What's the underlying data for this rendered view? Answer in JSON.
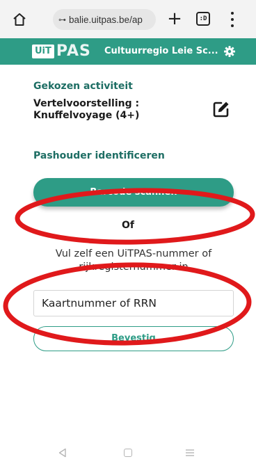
{
  "browser": {
    "url": "balie.uitpas.be/ap",
    "icons": [
      "home-icon",
      "site-settings-icon",
      "new-tab-plus-icon",
      "tab-switcher-icon",
      "overflow-menu-icon"
    ],
    "tab_switcher_label": ":D"
  },
  "app": {
    "logo_uit": "UiT",
    "logo_pas": "PAS",
    "organization": "Cultuurregio Leie Sc...",
    "brand_color": "#2e9c86",
    "heading_color": "#1e6e64"
  },
  "activity": {
    "section_label": "Gekozen activiteit",
    "name_line1": "Vertelvoorstelling :",
    "name_line2": "Knuffelvoyage (4+)"
  },
  "identify": {
    "section_label": "Pashouder identificeren",
    "scan_button": "Barcode scannen",
    "or_label": "Of",
    "instruction_line1": "Vul zelf een UiTPAS-nummer of",
    "instruction_line2": "rijkregisternummer in",
    "input_placeholder": "Kaartnummer of RRN",
    "input_value": "",
    "confirm_button": "Bevestig"
  },
  "annotations": {
    "color": "#e0191b",
    "count": 2
  }
}
